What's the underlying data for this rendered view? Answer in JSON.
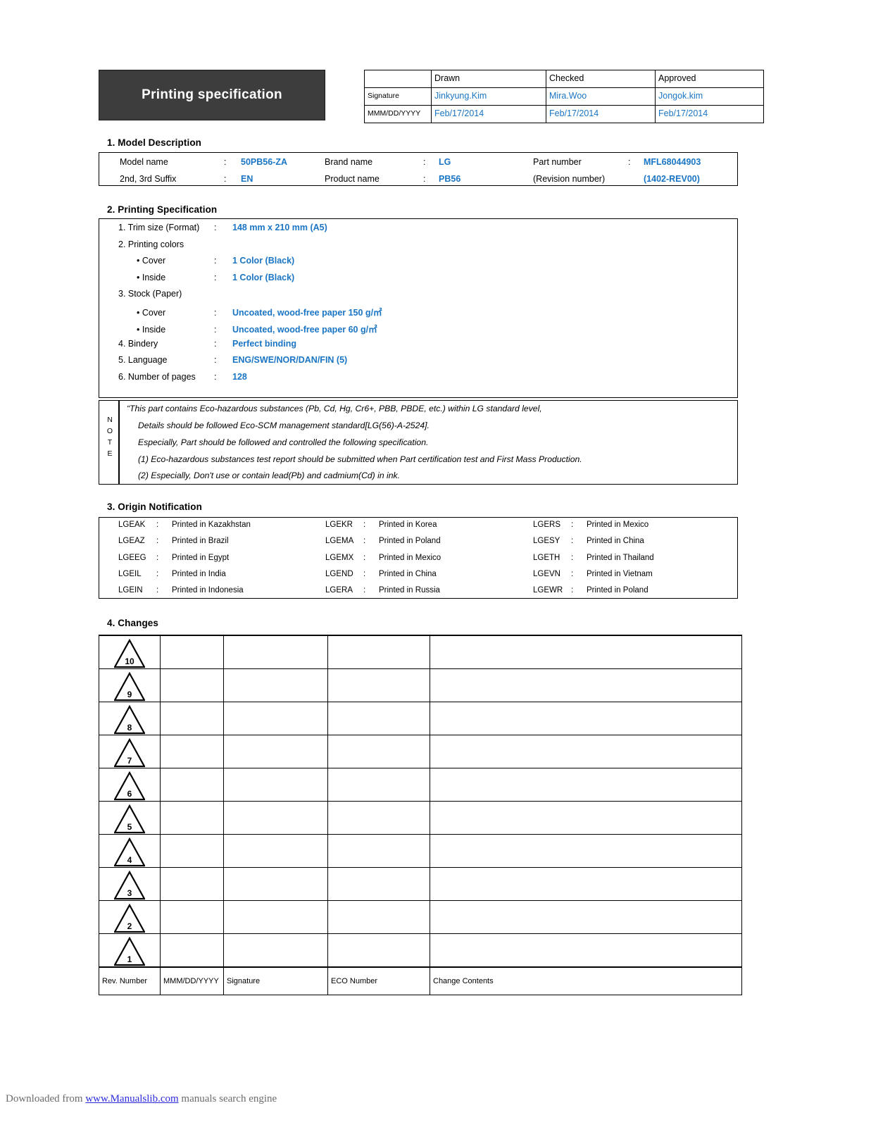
{
  "header": {
    "title": "Printing specification",
    "columns": [
      "",
      "Drawn",
      "Checked",
      "Approved"
    ],
    "row_signature_label": "Signature",
    "row_date_label": "MMM/DD/YYYY",
    "signatures": [
      "Jinkyung.Kim",
      "Mira.Woo",
      "Jongok.kim"
    ],
    "dates": [
      "Feb/17/2014",
      "Feb/17/2014",
      "Feb/17/2014"
    ]
  },
  "sections": {
    "model": {
      "heading": "1. Model Description",
      "fields": [
        {
          "label": "Model name",
          "colon": ":",
          "value": "50PB56-ZA"
        },
        {
          "label": "Brand name",
          "colon": ":",
          "value": "LG"
        },
        {
          "label": "Part number",
          "colon": ":",
          "value": "MFL68044903"
        },
        {
          "label": "2nd, 3rd Suffix",
          "colon": ":",
          "value": "EN"
        },
        {
          "label": "Product name",
          "colon": ":",
          "value": "PB56"
        },
        {
          "label": "(Revision number)",
          "colon": "",
          "value": "(1402-REV00)"
        }
      ]
    },
    "printing": {
      "heading": "2. Printing Specification",
      "rows": [
        {
          "label": "1. Trim size (Format)",
          "colon": ":",
          "value": "148 mm x 210 mm (A5)",
          "indent": 0
        },
        {
          "label": "2. Printing colors",
          "colon": "",
          "value": "",
          "indent": 0
        },
        {
          "label": "• Cover",
          "colon": ":",
          "value": "1 Color (Black)",
          "indent": 1
        },
        {
          "label": "• Inside",
          "colon": ":",
          "value": "1 Color (Black)",
          "indent": 1
        },
        {
          "label": "3. Stock (Paper)",
          "colon": "",
          "value": "",
          "indent": 0
        },
        {
          "label": "• Cover",
          "colon": ":",
          "value": "Uncoated, wood-free paper 150 g/㎡",
          "indent": 1
        },
        {
          "label": "• Inside",
          "colon": ":",
          "value": "Uncoated, wood-free paper 60 g/㎡",
          "indent": 1
        },
        {
          "label": "4. Bindery",
          "colon": ":",
          "value": "Perfect binding",
          "indent": 0
        },
        {
          "label": "5. Language",
          "colon": ":",
          "value": "ENG/SWE/NOR/DAN/FIN (5)",
          "indent": 0
        },
        {
          "label": "6. Number of pages",
          "colon": ":",
          "value": "128",
          "indent": 0
        }
      ]
    },
    "note": {
      "side_label": "NOTE",
      "lines": [
        "“This part contains Eco-hazardous substances (Pb, Cd, Hg, Cr6+, PBB, PBDE, etc.) within LG standard level,",
        "Details should be followed Eco-SCM management standard[LG(56)-A-2524].",
        "Especially, Part should be followed and controlled the following specification.",
        "(1) Eco-hazardous substances test report should be submitted when Part certification test and First Mass Production.",
        "(2) Especially, Don't use or contain lead(Pb) and cadmium(Cd) in ink."
      ]
    },
    "origin": {
      "heading": "3. Origin Notification",
      "entries": [
        {
          "code": "LGEAK",
          "colon": ":",
          "text": "Printed in Kazakhstan"
        },
        {
          "code": "LGEKR",
          "colon": ":",
          "text": "Printed in Korea"
        },
        {
          "code": "LGERS",
          "colon": ":",
          "text": "Printed in Mexico"
        },
        {
          "code": "LGEAZ",
          "colon": ":",
          "text": "Printed in Brazil"
        },
        {
          "code": "LGEMA",
          "colon": ":",
          "text": "Printed in Poland"
        },
        {
          "code": "LGESY",
          "colon": ":",
          "text": "Printed in China"
        },
        {
          "code": "LGEEG",
          "colon": ":",
          "text": "Printed in Egypt"
        },
        {
          "code": "LGEMX",
          "colon": ":",
          "text": "Printed in Mexico"
        },
        {
          "code": "LGETH",
          "colon": ":",
          "text": "Printed in Thailand"
        },
        {
          "code": "LGEIL",
          "colon": ":",
          "text": "Printed in India"
        },
        {
          "code": "LGEND",
          "colon": ":",
          "text": "Printed in China"
        },
        {
          "code": "LGEVN",
          "colon": ":",
          "text": "Printed in Vietnam"
        },
        {
          "code": "LGEIN",
          "colon": ":",
          "text": "Printed in Indonesia"
        },
        {
          "code": "LGERA",
          "colon": ":",
          "text": "Printed in Russia"
        },
        {
          "code": "LGEWR",
          "colon": ":",
          "text": "Printed in Poland"
        }
      ]
    },
    "changes": {
      "heading": "4. Changes",
      "rev_numbers": [
        "10",
        "9",
        "8",
        "7",
        "6",
        "5",
        "4",
        "3",
        "2",
        "1"
      ],
      "footer_labels": [
        "Rev. Number",
        "MMM/DD/YYYY",
        "Signature",
        "ECO Number",
        "Change Contents"
      ],
      "empty_cells": [
        "",
        "",
        "",
        ""
      ]
    }
  },
  "footer": {
    "prefix": "Downloaded from ",
    "link": "www.Manualslib.com",
    "suffix": " manuals search engine"
  },
  "colors": {
    "accent_blue": "#1a75c4",
    "title_bg": "#3d3d3d",
    "link_blue": "#2b2bdd"
  }
}
